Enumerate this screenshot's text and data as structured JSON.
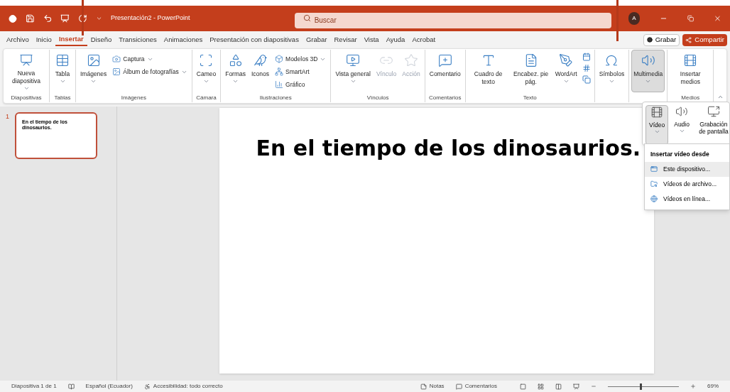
{
  "title_bar": {
    "file_name": "Presentación2 - PowerPoint",
    "search": {
      "placeholder": "Buscar"
    },
    "avatar": "A"
  },
  "tabs": [
    {
      "label": "Archivo",
      "selected": false
    },
    {
      "label": "Inicio",
      "selected": false
    },
    {
      "label": "Insertar",
      "selected": true
    },
    {
      "label": "Diseño",
      "selected": false
    },
    {
      "label": "Transiciones",
      "selected": false
    },
    {
      "label": "Animaciones",
      "selected": false
    },
    {
      "label": "Presentación con diapositivas",
      "selected": false
    },
    {
      "label": "Grabar",
      "selected": false
    },
    {
      "label": "Revisar",
      "selected": false
    },
    {
      "label": "Vista",
      "selected": false
    },
    {
      "label": "Ayuda",
      "selected": false
    },
    {
      "label": "Acrobat",
      "selected": false
    }
  ],
  "actions": {
    "record": "Grabar",
    "share": "Compartir"
  },
  "ribbon": [
    {
      "label": "Diapositivas",
      "items": [
        {
          "kind": "large",
          "label": "Nueva diapositiva",
          "dropdown": true,
          "disabled": false,
          "expanded": false
        }
      ]
    },
    {
      "label": "Tablas",
      "items": [
        {
          "kind": "large",
          "label": "Tabla",
          "dropdown": true,
          "disabled": false,
          "expanded": false
        }
      ]
    },
    {
      "label": "Imágenes",
      "items": [
        {
          "kind": "large",
          "label": "Imágenes",
          "dropdown": true,
          "disabled": false,
          "expanded": false
        },
        {
          "kind": "small",
          "label": "Captura",
          "dropdown": true,
          "disabled": false,
          "expanded": false
        },
        {
          "kind": "small",
          "label": "Álbum de fotografías",
          "dropdown": true,
          "disabled": false,
          "expanded": false
        }
      ]
    },
    {
      "label": "Cámara",
      "items": [
        {
          "kind": "large",
          "label": "Cameo",
          "dropdown": true,
          "disabled": false,
          "expanded": false
        }
      ]
    },
    {
      "label": "Ilustraciones",
      "items": [
        {
          "kind": "large",
          "label": "Formas",
          "dropdown": true,
          "disabled": false,
          "expanded": false
        },
        {
          "kind": "large",
          "label": "Iconos",
          "dropdown": false,
          "disabled": false,
          "expanded": false
        },
        {
          "kind": "small",
          "label": "Modelos 3D",
          "dropdown": true,
          "disabled": false,
          "expanded": false
        },
        {
          "kind": "small",
          "label": "SmartArt",
          "dropdown": false,
          "disabled": false,
          "expanded": false
        },
        {
          "kind": "small",
          "label": "Gráfico",
          "dropdown": false,
          "disabled": false,
          "expanded": false
        }
      ]
    },
    {
      "label": "Vínculos",
      "items": [
        {
          "kind": "large",
          "label": "Vista general",
          "dropdown": true,
          "disabled": false,
          "expanded": false
        },
        {
          "kind": "large",
          "label": "Vínculo",
          "dropdown": false,
          "disabled": true,
          "expanded": false
        },
        {
          "kind": "large",
          "label": "Acción",
          "dropdown": false,
          "disabled": true,
          "expanded": false
        }
      ]
    },
    {
      "label": "Comentarios",
      "items": [
        {
          "kind": "large",
          "label": "Comentario",
          "dropdown": false,
          "disabled": false,
          "expanded": false
        }
      ]
    },
    {
      "label": "Texto",
      "items": [
        {
          "kind": "large",
          "label": "Cuadro de texto",
          "dropdown": false,
          "disabled": false,
          "expanded": false
        },
        {
          "kind": "large",
          "label": "Encabez. pie pág.",
          "dropdown": false,
          "disabled": false,
          "expanded": false
        },
        {
          "kind": "large",
          "label": "WordArt",
          "dropdown": true,
          "disabled": false,
          "expanded": false
        },
        {
          "kind": "icons",
          "disabled": false
        }
      ]
    },
    {
      "items": [
        {
          "kind": "large",
          "label": "Símbolos",
          "dropdown": true,
          "disabled": false,
          "expanded": false
        }
      ]
    },
    {
      "items": [
        {
          "kind": "large",
          "label": "Multimedia",
          "dropdown": true,
          "disabled": false,
          "expanded": true
        }
      ]
    },
    {
      "label": "Medios",
      "items": [
        {
          "kind": "large",
          "label": "Insertar medios",
          "dropdown": false,
          "disabled": false,
          "expanded": false
        }
      ]
    }
  ],
  "media_panel": [
    {
      "label": "Vídeo",
      "dropdown": true,
      "selected": true
    },
    {
      "label": "Audio",
      "dropdown": true,
      "selected": false
    },
    {
      "label": "Grabación de pantalla",
      "dropdown": false,
      "selected": false
    }
  ],
  "video_menu": {
    "title": "Insertar vídeo desde",
    "items": [
      {
        "label": "Este dispositivo...",
        "selected": true
      },
      {
        "label": "Vídeos de archivo...",
        "selected": false
      },
      {
        "label": "Vídeos en línea...",
        "selected": false
      }
    ]
  },
  "thumbnails": [
    {
      "number": "1",
      "text": "En el tiempo de los dinosaurios.",
      "selected": true
    }
  ],
  "slide": {
    "title": "En el tiempo de los dinosaurios."
  },
  "status_bar": {
    "slide": "Diapositiva 1 de 1",
    "language": "Español (Ecuador)",
    "accessibility": "Accesibilidad: todo correcto",
    "notes": "Notas",
    "comments": "Comentarios",
    "zoom": {
      "level": 0.45
    },
    "zoom_text": "69%"
  }
}
